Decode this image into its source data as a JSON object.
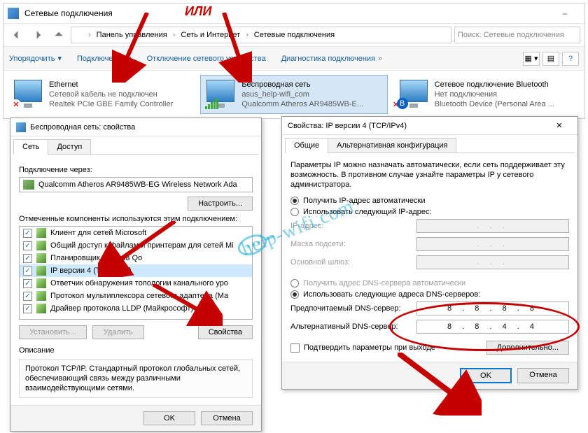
{
  "or_text": "ИЛИ",
  "watermark": "help-wifi.com",
  "explorer": {
    "title": "Сетевые подключения",
    "breadcrumb": [
      "Панель управления",
      "Сеть и Интернет",
      "Сетевые подключения"
    ],
    "search_placeholder": "Поиск: Сетевые подключения",
    "toolbar": {
      "sort": "Упорядочить",
      "connect": "Подключение к",
      "disable": "Отключение сетевого устройства",
      "diag": "Диагностика подключения"
    },
    "conns": [
      {
        "name": "Ethernet",
        "status": "Сетевой кабель не подключен",
        "adapter": "Realtek PCIe GBE Family Controller"
      },
      {
        "name": "Беспроводная сеть",
        "status": "asus_help-wifi_com",
        "adapter": "Qualcomm Atheros AR9485WB-E..."
      },
      {
        "name": "Сетевое подключение Bluetooth",
        "status": "Нет подключения",
        "adapter": "Bluetooth Device (Personal Area ..."
      }
    ]
  },
  "dlg1": {
    "title": "Беспроводная сеть: свойства",
    "tabs": [
      "Сеть",
      "Доступ"
    ],
    "conn_via": "Подключение через:",
    "adapter": "Qualcomm Atheros AR9485WB-EG Wireless Network Ada",
    "configure": "Настроить...",
    "comp_label": "Отмеченные компоненты используются этим подключением:",
    "components": [
      "Клиент для сетей Microsoft",
      "Общий доступ к файлам и принтерам для сетей Mi",
      "Планировщик пакетов Qo",
      "IP версии 4 (TCP/IPv4)",
      "Ответчик обнаружения топологии канального уро",
      "Протокол мультиплексора сетевого адаптера (Ма",
      "Драйвер протокола LLDP (Майкрософт)"
    ],
    "install": "Установить...",
    "remove": "Удалить",
    "props": "Свойства",
    "desc_label": "Описание",
    "desc_text": "Протокол TCP/IP. Стандартный протокол глобальных сетей, обеспечивающий связь между различными взаимодействующими сетями.",
    "ok": "OK",
    "cancel": "Отмена"
  },
  "dlg2": {
    "title": "Свойства: IP версии 4 (TCP/IPv4)",
    "tabs": [
      "Общие",
      "Альтернативная конфигурация"
    ],
    "info": "Параметры IP можно назначать автоматически, если сеть поддерживает эту возможность. В противном случае узнайте параметры IP у сетевого администратора.",
    "auto_ip": "Получить IP-адрес автоматически",
    "use_ip": "Использовать следующий IP-адрес:",
    "ip_label": "IP-адрес:",
    "mask_label": "Маска подсети:",
    "gw_label": "Основной шлюз:",
    "auto_dns": "Получить адрес DNS-сервера автоматически",
    "use_dns": "Использовать следующие адреса DNS-серверов:",
    "dns1_label": "Предпочитаемый DNS-сервер:",
    "dns2_label": "Альтернативный DNS-сервер:",
    "dns1": "8 . 8 . 8 . 8",
    "dns2": "8 . 8 . 4 . 4",
    "confirm_exit": "Подтвердить параметры при выходе",
    "advanced": "Дополнительно...",
    "ok": "OK",
    "cancel": "Отмена"
  }
}
